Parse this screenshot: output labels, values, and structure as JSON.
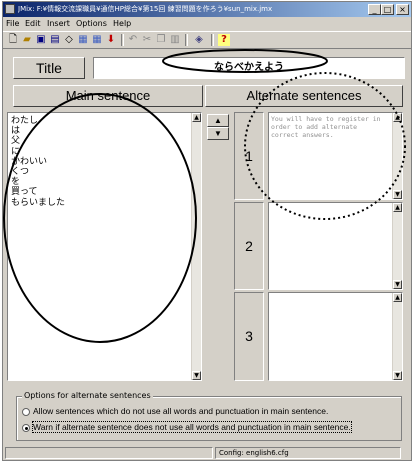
{
  "window": {
    "title": "JMix: F:¥情報交流課職員¥通信HP総合¥第15回 練習問題を作ろう¥sun_mix.jmx"
  },
  "menu": [
    "File",
    "Edit",
    "Insert",
    "Options",
    "Help"
  ],
  "title_label": "Title",
  "title_value": "ならべかえよう",
  "main_header": "Main sentence",
  "alt_header": "Alternate sentences",
  "main_lines": [
    "わたし",
    "は",
    "父",
    "に",
    "かわいい",
    "くつ",
    "を",
    "買って",
    "もらいました"
  ],
  "alt_placeholder": "You will have to register in order to add alternate correct answers.",
  "alt_numbers": [
    "1",
    "2",
    "3"
  ],
  "options": {
    "legend": "Options for alternate sentences",
    "opt1": "Allow sentences which do not use all words and punctuation in main sentence.",
    "opt2": "Warn if alternate sentence does not use all words and punctuation in main sentence.",
    "selected": 2
  },
  "status": {
    "config": "Config: english6.cfg"
  },
  "colors": {
    "title_start": "#0a246a",
    "title_end": "#a6caf0",
    "face": "#d4d0c8"
  }
}
